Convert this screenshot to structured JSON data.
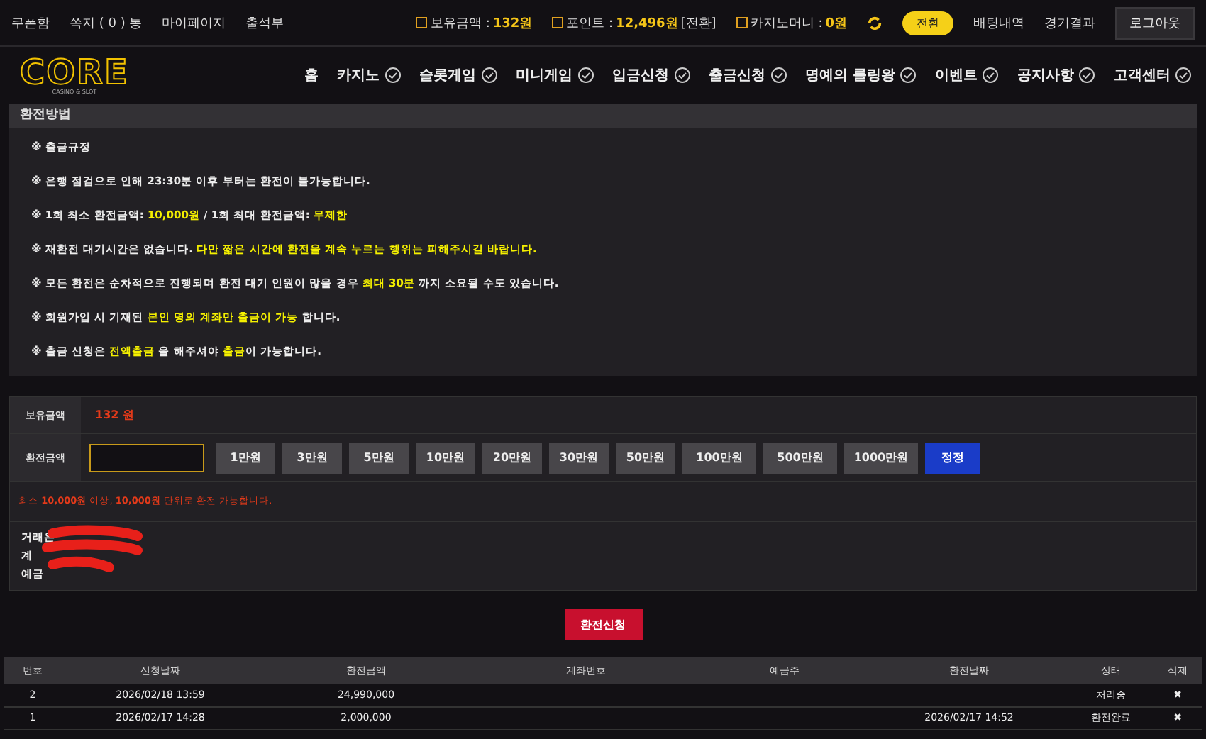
{
  "top_links": [
    "쿠폰함",
    "쪽지 ( 0 ) 통",
    "마이페이지",
    "출석부"
  ],
  "wallet": [
    {
      "label": "보유금액 :",
      "value": "132원"
    },
    {
      "label": "포인트 :",
      "value": "12,496원",
      "suffix": "[전환]"
    },
    {
      "label": "카지노머니 :",
      "value": "0원"
    }
  ],
  "convert_button": "전환",
  "top_right": [
    "배팅내역",
    "경기결과"
  ],
  "logout": "로그아웃",
  "logo": {
    "main": "CORE",
    "sub": "CASINO & SLOT"
  },
  "nav": [
    {
      "label": "홈",
      "kind": "plain"
    },
    {
      "label": "카지노",
      "kind": "check"
    },
    {
      "label": "슬롯게임",
      "kind": "check"
    },
    {
      "label": "미니게임",
      "kind": "check"
    },
    {
      "label": "입금신청",
      "kind": "check"
    },
    {
      "label": "출금신청",
      "kind": "check"
    },
    {
      "label": "명예의 롤링왕",
      "kind": "check"
    },
    {
      "label": "이벤트",
      "kind": "check"
    },
    {
      "label": "공지사항",
      "kind": "check"
    },
    {
      "label": "고객센터",
      "kind": "check"
    }
  ],
  "panel_title": "환전방법",
  "rules": [
    [
      {
        "text": "※ 출금규정",
        "hl": false
      }
    ],
    [
      {
        "text": "※ 은행 점검으로 인해 23:30분 이후 부터는 환전이 불가능합니다.",
        "hl": false
      }
    ],
    [
      {
        "text": "※ 1회 최소 환전금액: ",
        "hl": false
      },
      {
        "text": "10,000원",
        "hl": true
      },
      {
        "text": " / 1회 최대 환전금액: ",
        "hl": false
      },
      {
        "text": "무제한",
        "hl": true
      }
    ],
    [
      {
        "text": "※ 재환전 대기시간은 없습니다. ",
        "hl": false
      },
      {
        "text": "다만 짧은 시간에 환전을 계속 누르는 행위는 피해주시길 바랍니다.",
        "hl": true
      }
    ],
    [
      {
        "text": "※ 모든 환전은 순차적으로 진행되며 환전 대기 인원이 많을 경우 ",
        "hl": false
      },
      {
        "text": "최대 30분",
        "hl": true
      },
      {
        "text": " 까지 소요될 수도 있습니다.",
        "hl": false
      }
    ],
    [
      {
        "text": "※ 회원가입 시 기재된 ",
        "hl": false
      },
      {
        "text": "본인 명의 계좌만 출금이 가능",
        "hl": true
      },
      {
        "text": " 합니다.",
        "hl": false
      }
    ],
    [
      {
        "text": "※ 출금 신청은 ",
        "hl": false
      },
      {
        "text": "전액출금",
        "hl": true
      },
      {
        "text": " 을 해주셔야 ",
        "hl": false
      },
      {
        "text": "출금",
        "hl": true
      },
      {
        "text": "이 가능합니다.",
        "hl": false
      }
    ]
  ],
  "balance": {
    "label": "보유금액",
    "value": "132 원"
  },
  "amount": {
    "label": "환전금액",
    "presets": [
      "1만원",
      "3만원",
      "5만원",
      "10만원",
      "20만원",
      "30만원",
      "50만원",
      "100만원",
      "500만원",
      "1000만원"
    ],
    "reset": "정정"
  },
  "notice": "최소 **10,000원** 이상, **10,000원** 단위로 환전 가능합니다.",
  "account_labels": [
    "거래은",
    "계",
    "예금"
  ],
  "submit": "환전신청",
  "table": {
    "columns": [
      "번호",
      "신청날짜",
      "환전금액",
      "계좌번호",
      "예금주",
      "환전날짜",
      "상태",
      "삭제"
    ],
    "rows": [
      [
        "2",
        "2026/02/18 13:59",
        "24,990,000",
        "",
        "",
        "",
        "처리중",
        "✖"
      ],
      [
        "1",
        "2026/02/17 14:28",
        "2,000,000",
        "",
        "",
        "2026/02/17 14:52",
        "환전완료",
        "✖"
      ]
    ]
  }
}
